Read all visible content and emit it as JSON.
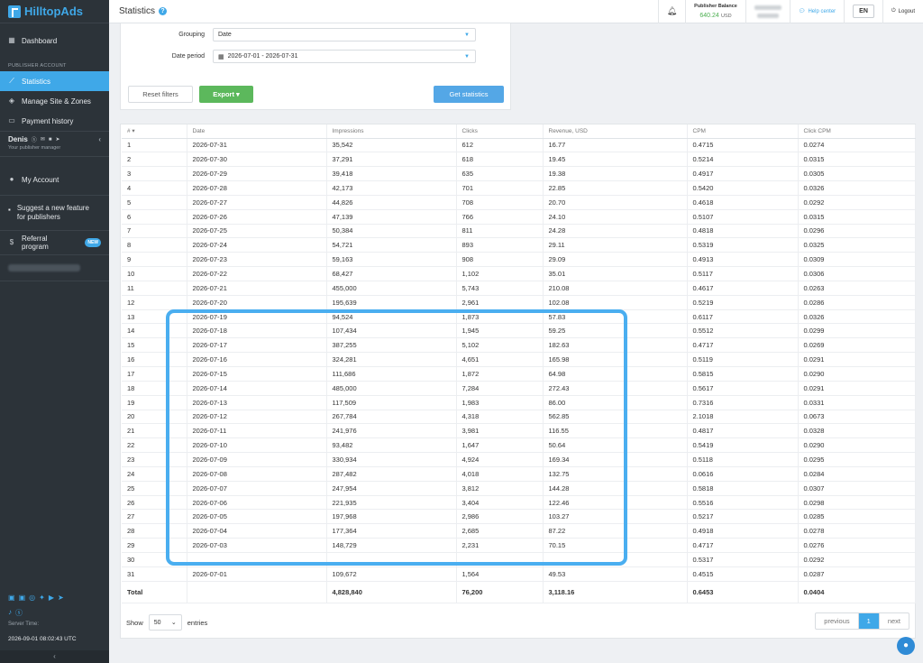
{
  "logo": {
    "text": "HilltopAds"
  },
  "sidebar": {
    "dashboard": "Dashboard",
    "section": "PUBLISHER ACCOUNT",
    "statistics": "Statistics",
    "manage": "Manage Site & Zones",
    "payment": "Payment history",
    "manager_name": "Denis",
    "manager_role": "Your publisher manager",
    "my_account": "My Account",
    "suggest": "Suggest a new feature for publishers",
    "referral": "Referral program",
    "referral_badge": "NEW",
    "server_label": "Server Time:",
    "server_time": "2026-09-01 08:02:43 UTC"
  },
  "topbar": {
    "title": "Statistics",
    "balance_label": "Publisher Balance",
    "balance_value": "640.24",
    "balance_currency": "USD",
    "help": "Help center",
    "lang": "EN",
    "logout": "Logout"
  },
  "filters": {
    "grouping_label": "Grouping",
    "grouping_value": "Date",
    "period_label": "Date period",
    "period_value": "2026-07-01 - 2026-07-31",
    "reset": "Reset filters",
    "export": "Export ▾",
    "get": "Get statistics"
  },
  "table": {
    "headers": [
      "# ▾",
      "Date",
      "Impressions",
      "Clicks",
      "Revenue, USD",
      "CPM",
      "Click CPM"
    ],
    "rows": [
      [
        "1",
        "2026-07-31",
        "35,542",
        "612",
        "16.77",
        "0.4715",
        "0.0274"
      ],
      [
        "2",
        "2026-07-30",
        "37,291",
        "618",
        "19.45",
        "0.5214",
        "0.0315"
      ],
      [
        "3",
        "2026-07-29",
        "39,418",
        "635",
        "19.38",
        "0.4917",
        "0.0305"
      ],
      [
        "4",
        "2026-07-28",
        "42,173",
        "701",
        "22.85",
        "0.5420",
        "0.0326"
      ],
      [
        "5",
        "2026-07-27",
        "44,826",
        "708",
        "20.70",
        "0.4618",
        "0.0292"
      ],
      [
        "6",
        "2026-07-26",
        "47,139",
        "766",
        "24.10",
        "0.5107",
        "0.0315"
      ],
      [
        "7",
        "2026-07-25",
        "50,384",
        "811",
        "24.28",
        "0.4818",
        "0.0296"
      ],
      [
        "8",
        "2026-07-24",
        "54,721",
        "893",
        "29.11",
        "0.5319",
        "0.0325"
      ],
      [
        "9",
        "2026-07-23",
        "59,163",
        "908",
        "29.09",
        "0.4913",
        "0.0309"
      ],
      [
        "10",
        "2026-07-22",
        "68,427",
        "1,102",
        "35.01",
        "0.5117",
        "0.0306"
      ],
      [
        "11",
        "2026-07-21",
        "455,000",
        "5,743",
        "210.08",
        "0.4617",
        "0.0263"
      ],
      [
        "12",
        "2026-07-20",
        "195,639",
        "2,961",
        "102.08",
        "0.5219",
        "0.0286"
      ],
      [
        "13",
        "2026-07-19",
        "94,524",
        "1,873",
        "57.83",
        "0.6117",
        "0.0326"
      ],
      [
        "14",
        "2026-07-18",
        "107,434",
        "1,945",
        "59.25",
        "0.5512",
        "0.0299"
      ],
      [
        "15",
        "2026-07-17",
        "387,255",
        "5,102",
        "182.63",
        "0.4717",
        "0.0269"
      ],
      [
        "16",
        "2026-07-16",
        "324,281",
        "4,651",
        "165.98",
        "0.5119",
        "0.0291"
      ],
      [
        "17",
        "2026-07-15",
        "111,686",
        "1,872",
        "64.98",
        "0.5815",
        "0.0290"
      ],
      [
        "18",
        "2026-07-14",
        "485,000",
        "7,284",
        "272.43",
        "0.5617",
        "0.0291"
      ],
      [
        "19",
        "2026-07-13",
        "117,509",
        "1,983",
        "86.00",
        "0.7316",
        "0.0331"
      ],
      [
        "20",
        "2026-07-12",
        "267,784",
        "4,318",
        "562.85",
        "2.1018",
        "0.0673"
      ],
      [
        "21",
        "2026-07-11",
        "241,976",
        "3,981",
        "116.55",
        "0.4817",
        "0.0328"
      ],
      [
        "22",
        "2026-07-10",
        "93,482",
        "1,647",
        "50.64",
        "0.5419",
        "0.0290"
      ],
      [
        "23",
        "2026-07-09",
        "330,934",
        "4,924",
        "169.34",
        "0.5118",
        "0.0295"
      ],
      [
        "24",
        "2026-07-08",
        "287,482",
        "4,018",
        "132.75",
        "0.0616",
        "0.0284"
      ],
      [
        "25",
        "2026-07-07",
        "247,954",
        "3,812",
        "144.28",
        "0.5818",
        "0.0307"
      ],
      [
        "26",
        "2026-07-06",
        "221,935",
        "3,404",
        "122.46",
        "0.5516",
        "0.0298"
      ],
      [
        "27",
        "2026-07-05",
        "197,968",
        "2,986",
        "103.27",
        "0.5217",
        "0.0285"
      ],
      [
        "28",
        "2026-07-04",
        "177,364",
        "2,685",
        "87.22",
        "0.4918",
        "0.0278"
      ],
      [
        "29",
        "2026-07-03",
        "148,729",
        "2,231",
        "70.15",
        "0.4717",
        "0.0276"
      ],
      [
        "30",
        "",
        "",
        "",
        "",
        "0.5317",
        "0.0292"
      ],
      [
        "31",
        "2026-07-01",
        "109,672",
        "1,564",
        "49.53",
        "0.4515",
        "0.0287"
      ]
    ],
    "total": [
      "Total",
      "",
      "4,828,840",
      "76,200",
      "3,118.16",
      "0.6453",
      "0.0404"
    ]
  },
  "footer": {
    "show": "Show",
    "entries_value": "50",
    "entries": "entries",
    "previous": "previous",
    "page": "1",
    "next": "next"
  }
}
